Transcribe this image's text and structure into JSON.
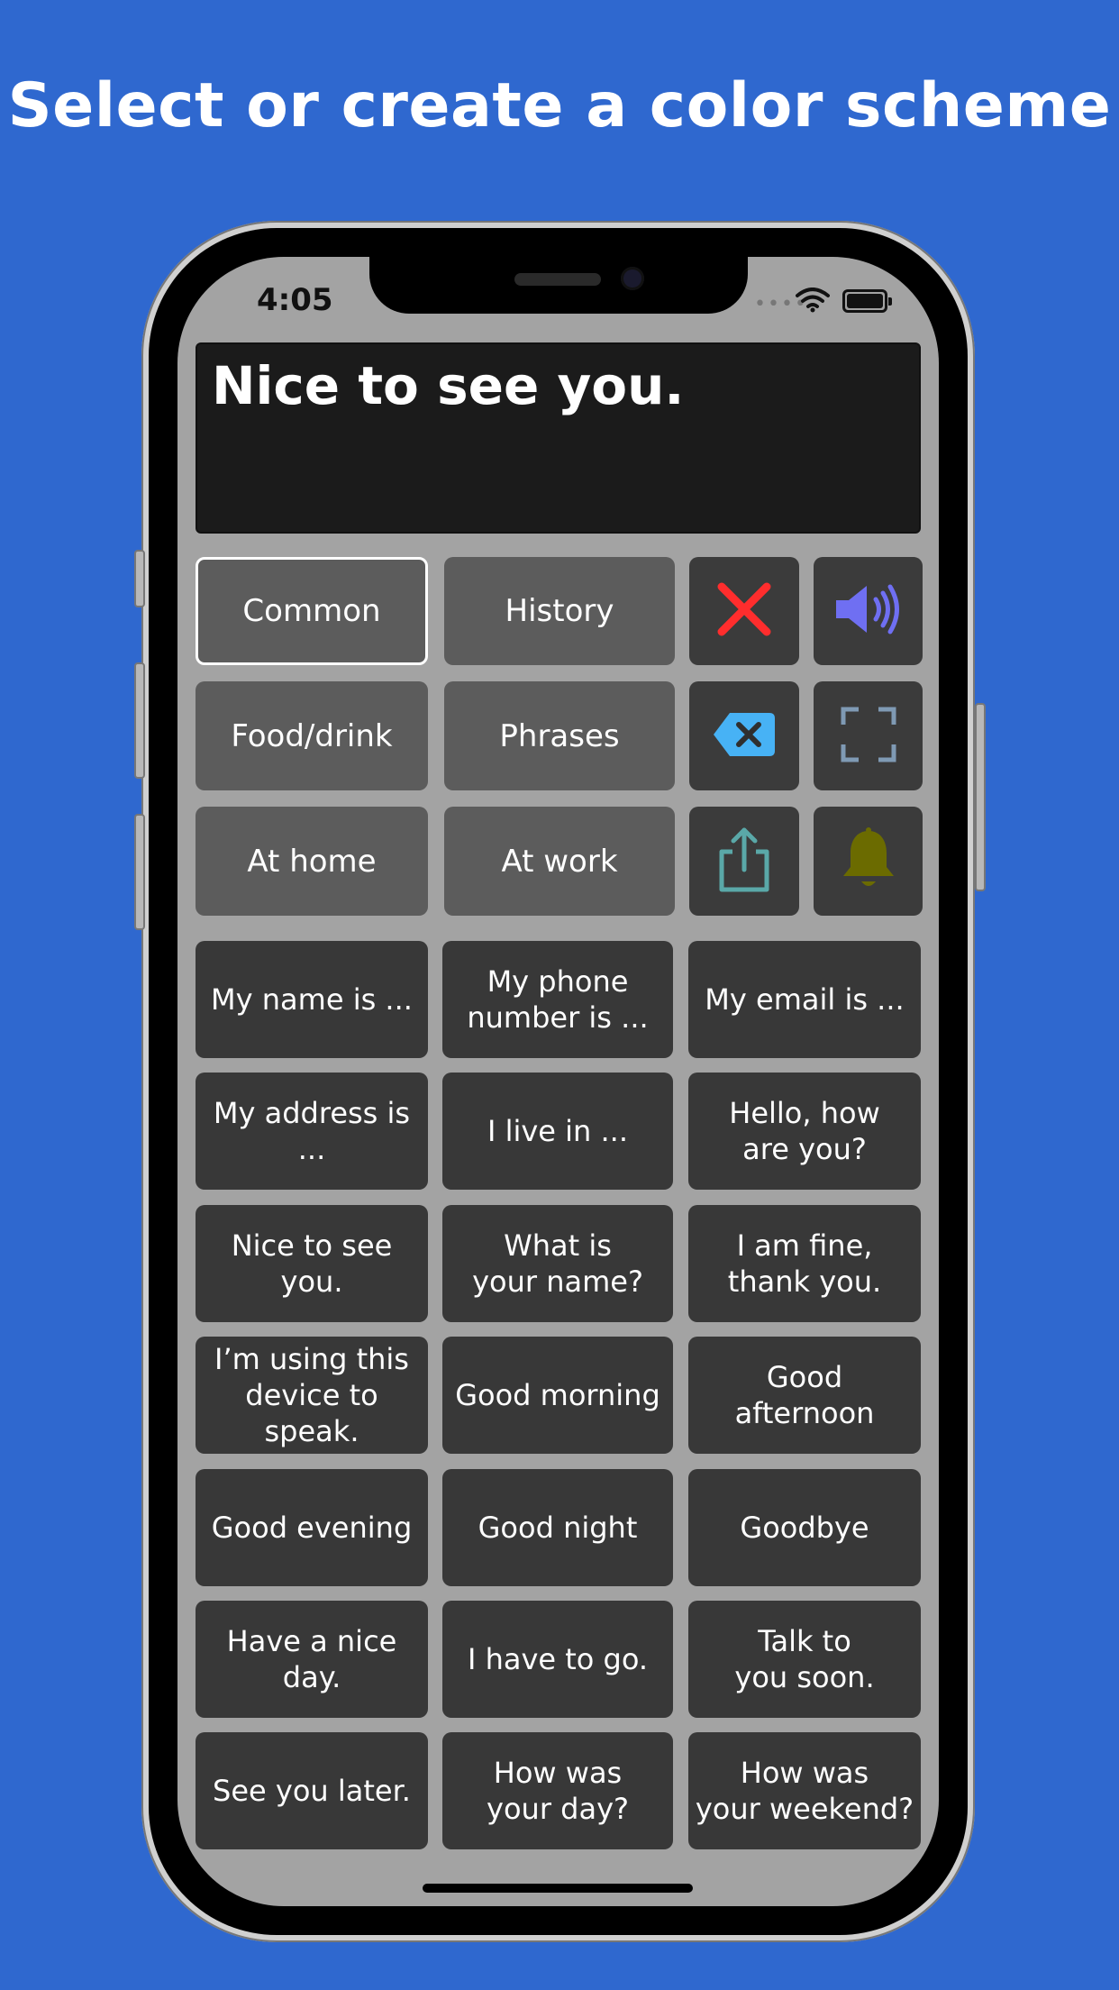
{
  "headline": "Select or create a color scheme",
  "status_bar": {
    "time": "4:05",
    "signal_dots": "••••"
  },
  "display_text": "Nice to see you.",
  "categories": [
    {
      "label": "Common",
      "selected": true
    },
    {
      "label": "History",
      "selected": false
    },
    {
      "label": "Food/drink",
      "selected": false
    },
    {
      "label": "Phrases",
      "selected": false
    },
    {
      "label": "At home",
      "selected": false
    },
    {
      "label": "At work",
      "selected": false
    }
  ],
  "tools": {
    "clear": {
      "icon": "close-icon",
      "color": "#ff2d2d"
    },
    "speak": {
      "icon": "speaker-icon",
      "color": "#6f6ff2"
    },
    "backspace": {
      "icon": "backspace-icon",
      "color": "#47b2f5"
    },
    "fullscreen": {
      "icon": "fullscreen-icon",
      "color": "#7f9ab4"
    },
    "share": {
      "icon": "share-icon",
      "color": "#5aa8a8"
    },
    "bell": {
      "icon": "bell-icon",
      "color": "#6b6b00"
    }
  },
  "phrases": [
    "My name is ...",
    "My phone\nnumber is ...",
    "My email is ...",
    "My address is ...",
    "I live in ...",
    "Hello, how\nare you?",
    "Nice to see you.",
    "What is\nyour name?",
    "I am fine,\nthank you.",
    "I’m using this\ndevice to speak.",
    "Good morning",
    "Good afternoon",
    "Good evening",
    "Good night",
    "Goodbye",
    "Have a nice day.",
    "I have to go.",
    "Talk to\nyou soon.",
    "See you later.",
    "How was\nyour day?",
    "How was\nyour weekend?"
  ]
}
